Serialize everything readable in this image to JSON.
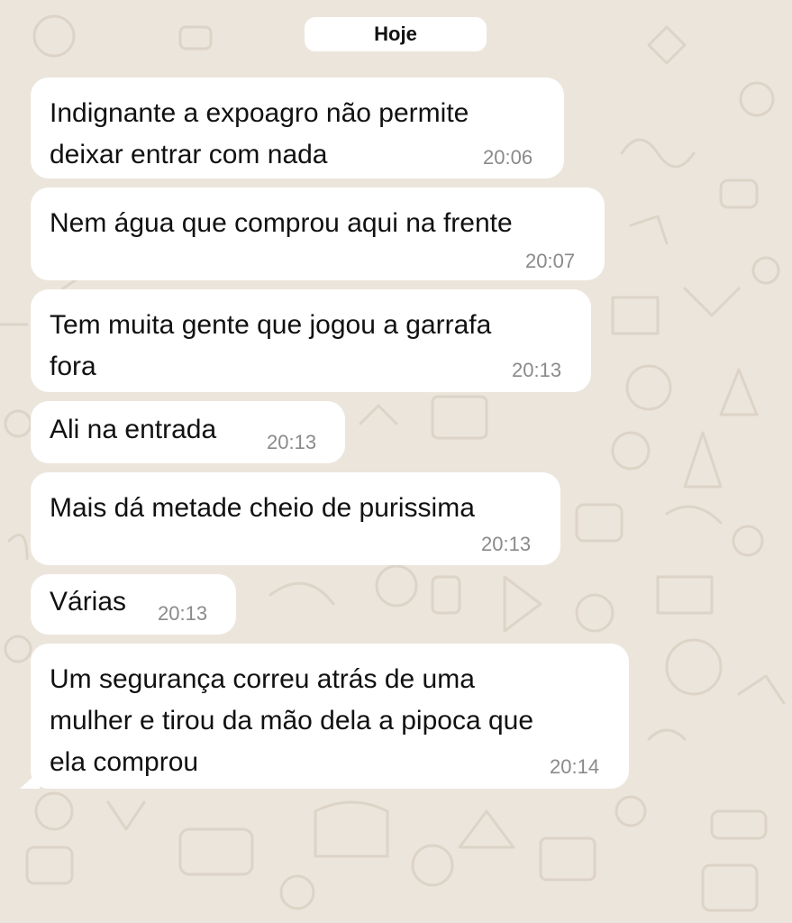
{
  "chat": {
    "date_separator": "Hoje",
    "messages": [
      {
        "lines": [
          "Indignante a expoagro não permite",
          "deixar entrar com nada"
        ],
        "time": "20:06"
      },
      {
        "lines": [
          "Nem água que comprou aqui na frente"
        ],
        "time": "20:07"
      },
      {
        "lines": [
          "Tem muita gente que jogou a garrafa",
          "fora"
        ],
        "time": "20:13"
      },
      {
        "lines": [
          "Ali na entrada"
        ],
        "time": "20:13"
      },
      {
        "lines": [
          "Mais dá metade cheio de purissima"
        ],
        "time": "20:13"
      },
      {
        "lines": [
          "Várias"
        ],
        "time": "20:13"
      },
      {
        "lines": [
          "Um segurança correu atrás de uma",
          "mulher e tirou da mão dela a pipoca que",
          "ela comprou"
        ],
        "time": "20:14"
      }
    ]
  },
  "colors": {
    "background": "#ece5dc",
    "bubble": "#ffffff",
    "text": "#111111",
    "time": "#8a8a8a",
    "doodle": "#ddd4c7"
  }
}
